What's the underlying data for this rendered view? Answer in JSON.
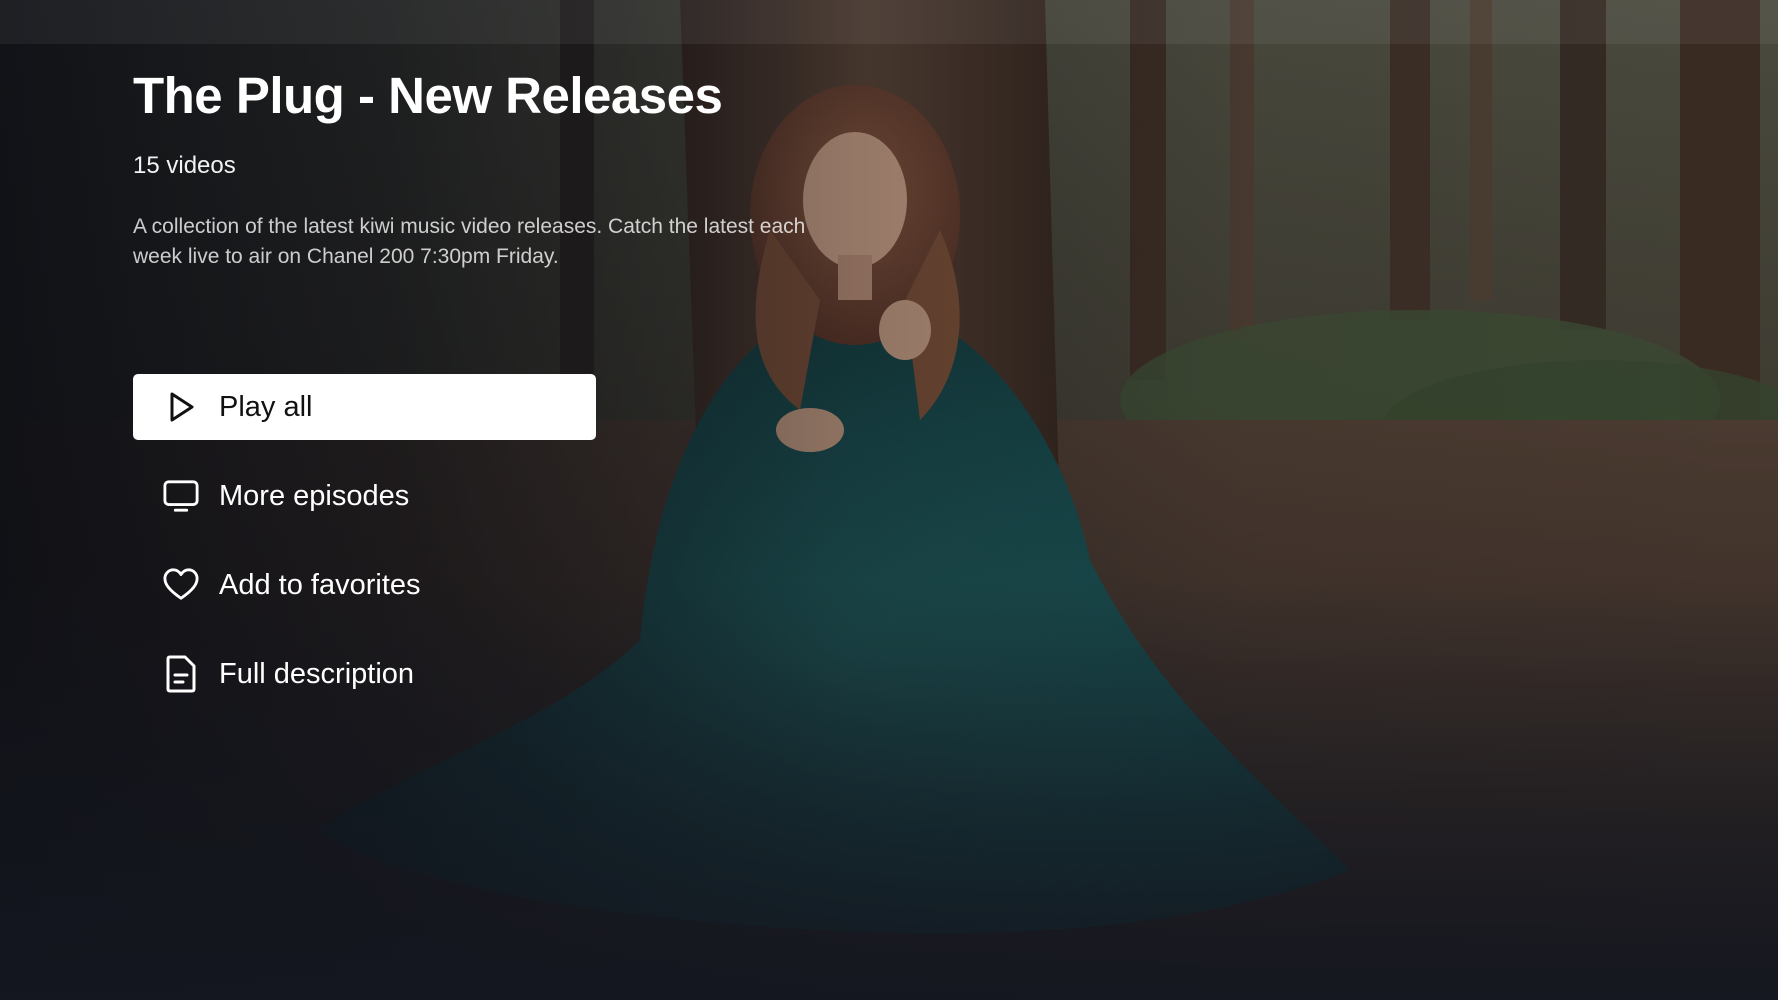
{
  "playlist": {
    "title": "The Plug - New Releases",
    "video_count": "15 videos",
    "description": "A collection of the latest kiwi music video releases. Catch the latest each week live to air on Chanel 200 7:30pm Friday."
  },
  "actions": [
    {
      "label": "Play all",
      "icon": "play-icon",
      "focused": true
    },
    {
      "label": "More episodes",
      "icon": "tv-icon",
      "focused": false
    },
    {
      "label": "Add to favorites",
      "icon": "heart-icon",
      "focused": false
    },
    {
      "label": "Full description",
      "icon": "document-icon",
      "focused": false
    }
  ],
  "colors": {
    "focused_button_bg": "#ffffff",
    "focused_button_text": "#111111",
    "text": "#ffffff",
    "background": "#1b1e24"
  }
}
